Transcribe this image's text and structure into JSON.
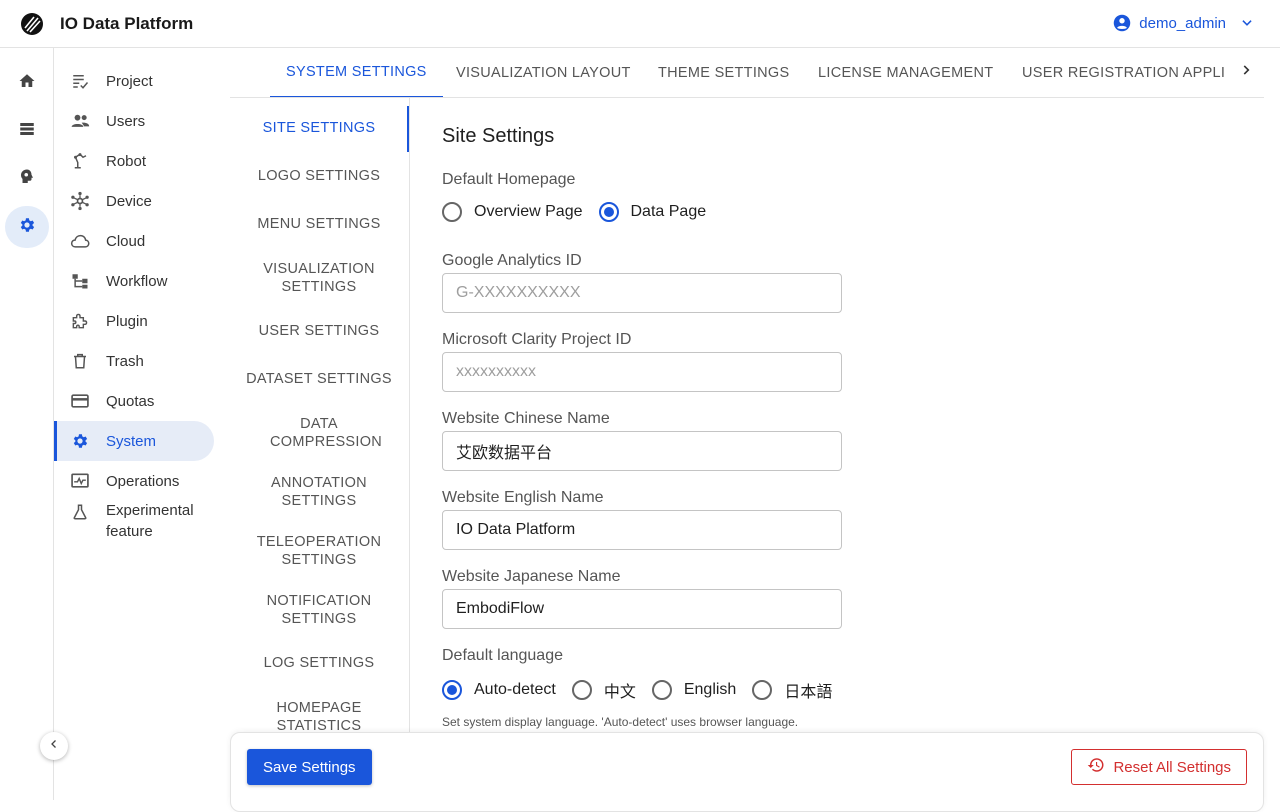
{
  "app": {
    "title": "IO Data Platform"
  },
  "user": {
    "name": "demo_admin"
  },
  "colors": {
    "accent": "#1a56db",
    "danger": "#d32f2f",
    "active_bg": "#e6ecf7"
  },
  "rail": [
    {
      "icon": "home-icon"
    },
    {
      "icon": "list-icon"
    },
    {
      "icon": "brain-icon"
    },
    {
      "icon": "gear-icon",
      "active": true
    }
  ],
  "sidebar": {
    "items": [
      {
        "label": "Project",
        "icon": "project-icon"
      },
      {
        "label": "Users",
        "icon": "users-icon"
      },
      {
        "label": "Robot",
        "icon": "robot-arm-icon"
      },
      {
        "label": "Device",
        "icon": "device-hub-icon"
      },
      {
        "label": "Cloud",
        "icon": "cloud-icon"
      },
      {
        "label": "Workflow",
        "icon": "workflow-icon"
      },
      {
        "label": "Plugin",
        "icon": "plugin-icon"
      },
      {
        "label": "Trash",
        "icon": "trash-icon"
      },
      {
        "label": "Quotas",
        "icon": "card-icon"
      },
      {
        "label": "System",
        "icon": "gear-icon",
        "active": true
      },
      {
        "label": "Operations",
        "icon": "monitor-icon"
      },
      {
        "label": "Experimental feature",
        "icon": "flask-icon"
      }
    ]
  },
  "tabs": [
    {
      "label": "SYSTEM SETTINGS",
      "active": true
    },
    {
      "label": "VISUALIZATION LAYOUT"
    },
    {
      "label": "THEME SETTINGS"
    },
    {
      "label": "LICENSE MANAGEMENT"
    },
    {
      "label": "USER REGISTRATION APPLICATIONS"
    }
  ],
  "sections": [
    {
      "label": "SITE SETTINGS",
      "active": true
    },
    {
      "label": "LOGO SETTINGS"
    },
    {
      "label": "MENU SETTINGS"
    },
    {
      "label": "VISUALIZATION SETTINGS"
    },
    {
      "label": "USER SETTINGS"
    },
    {
      "label": "DATASET SETTINGS"
    },
    {
      "label": "DATA COMPRESSION"
    },
    {
      "label": "ANNOTATION SETTINGS"
    },
    {
      "label": "TELEOPERATION SETTINGS"
    },
    {
      "label": "NOTIFICATION SETTINGS"
    },
    {
      "label": "LOG SETTINGS"
    },
    {
      "label": "HOMEPAGE STATISTICS"
    }
  ],
  "form": {
    "title": "Site Settings",
    "default_homepage": {
      "label": "Default Homepage",
      "options": [
        "Overview Page",
        "Data Page"
      ],
      "selected": "Data Page"
    },
    "ga_id": {
      "label": "Google Analytics ID",
      "value": "",
      "placeholder": "G-XXXXXXXXXX"
    },
    "clarity_id": {
      "label": "Microsoft Clarity Project ID",
      "value": "",
      "placeholder": "xxxxxxxxxx"
    },
    "name_zh": {
      "label": "Website Chinese Name",
      "value": "艾欧数据平台"
    },
    "name_en": {
      "label": "Website English Name",
      "value": "IO Data Platform"
    },
    "name_ja": {
      "label": "Website Japanese Name",
      "value": "EmbodiFlow"
    },
    "default_language": {
      "label": "Default language",
      "options": [
        "Auto-detect",
        "中文",
        "English",
        "日本語"
      ],
      "selected": "Auto-detect",
      "hint": "Set system display language. 'Auto-detect' uses browser language."
    }
  },
  "footer": {
    "save_label": "Save Settings",
    "reset_label": "Reset All Settings"
  }
}
